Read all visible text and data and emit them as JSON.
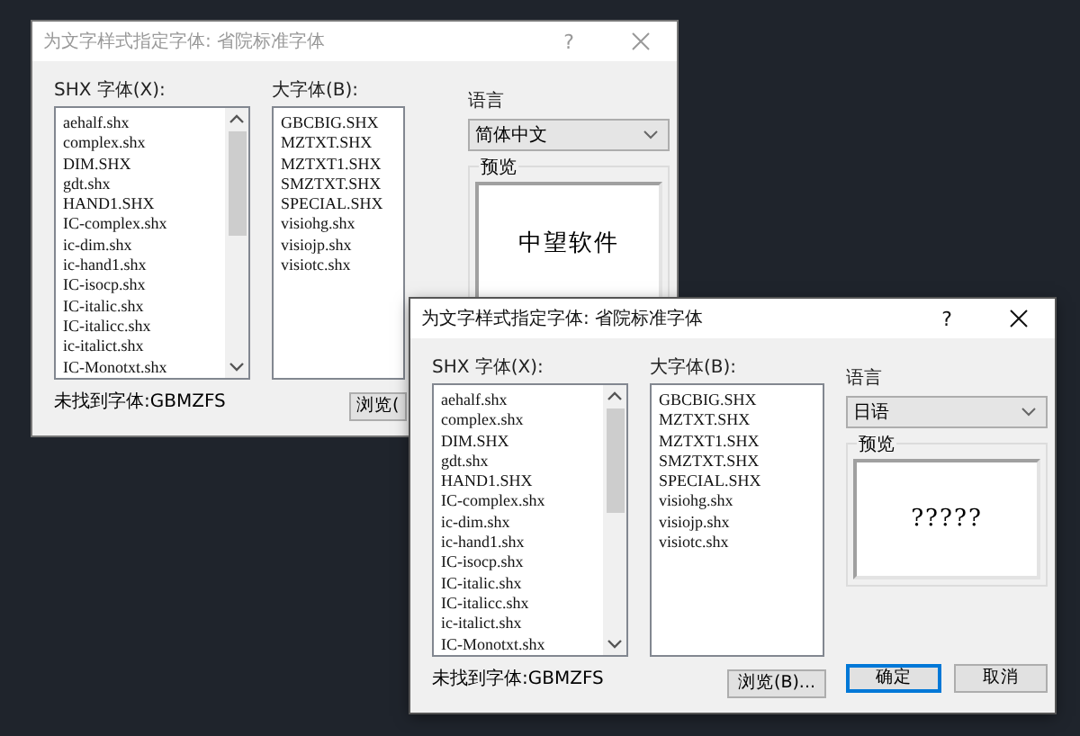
{
  "dialogs": [
    {
      "title": "为文字样式指定字体: 省院标准字体",
      "active": false,
      "help_button": "?",
      "shx_label": "SHX 字体(X):",
      "shx_fonts": [
        "aehalf.shx",
        "complex.shx",
        "DIM.SHX",
        "gdt.shx",
        "HAND1.SHX",
        "IC-complex.shx",
        "ic-dim.shx",
        "ic-hand1.shx",
        "IC-isocp.shx",
        "IC-italic.shx",
        "IC-italicc.shx",
        "ic-italict.shx",
        "IC-Monotxt.shx"
      ],
      "big_label": "大字体(B):",
      "big_fonts": [
        "GBCBIG.SHX",
        "MZTXT.SHX",
        "MZTXT1.SHX",
        "SMZTXT.SHX",
        "SPECIAL.SHX",
        "visiohg.shx",
        "visiojp.shx",
        "visiotc.shx"
      ],
      "language_label": "语言",
      "language": "简体中文",
      "preview_label": "预览",
      "preview_text": "中望软件",
      "status": "未找到字体:GBMZFS",
      "buttons": [
        {
          "label": "浏览(",
          "default": false
        }
      ]
    },
    {
      "title": "为文字样式指定字体: 省院标准字体",
      "active": true,
      "help_button": "?",
      "shx_label": "SHX 字体(X):",
      "shx_fonts": [
        "aehalf.shx",
        "complex.shx",
        "DIM.SHX",
        "gdt.shx",
        "HAND1.SHX",
        "IC-complex.shx",
        "ic-dim.shx",
        "ic-hand1.shx",
        "IC-isocp.shx",
        "IC-italic.shx",
        "IC-italicc.shx",
        "ic-italict.shx",
        "IC-Monotxt.shx"
      ],
      "big_label": "大字体(B):",
      "big_fonts": [
        "GBCBIG.SHX",
        "MZTXT.SHX",
        "MZTXT1.SHX",
        "SMZTXT.SHX",
        "SPECIAL.SHX",
        "visiohg.shx",
        "visiojp.shx",
        "visiotc.shx"
      ],
      "language_label": "语言",
      "language": "日语",
      "preview_label": "预览",
      "preview_text": "?????",
      "status": "未找到字体:GBMZFS",
      "buttons": [
        {
          "label": "浏览(B)...",
          "default": false
        },
        {
          "label": "确定",
          "default": true
        },
        {
          "label": "取消",
          "default": false
        }
      ]
    }
  ]
}
